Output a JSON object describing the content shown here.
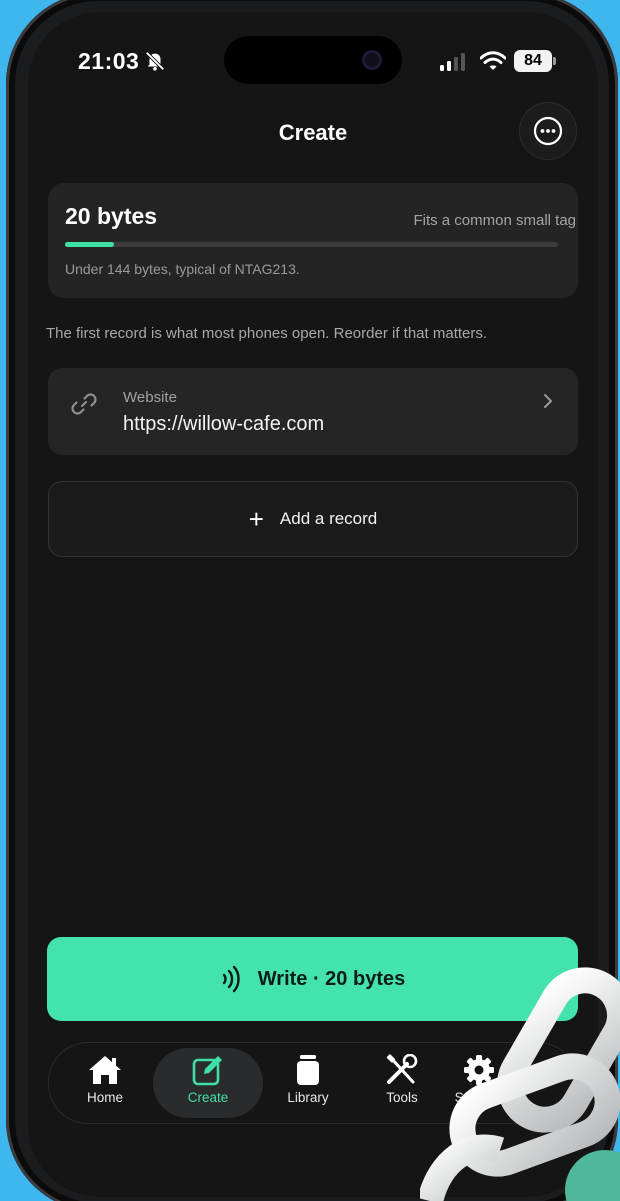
{
  "status_bar": {
    "time": "21:03",
    "battery": "84"
  },
  "header": {
    "title": "Create",
    "more_icon": "ellipsis-circle-icon"
  },
  "usage": {
    "bytes_label": "20 bytes",
    "fit_label": "Fits a common small tag",
    "note": "Under 144 bytes, typical of NTAG213.",
    "fill_fraction": 0.1,
    "accent_color": "#3ee0a6"
  },
  "hint": "The first record is what most phones open. Reorder if that matters.",
  "records": [
    {
      "type": "Website",
      "value": "https://willow-cafe.com",
      "icon": "link-icon"
    }
  ],
  "add_record": {
    "label": "Add a record"
  },
  "write_button": {
    "label": "Write · 20 bytes",
    "color": "#44e2ad"
  },
  "tabs": [
    {
      "label": "Home",
      "icon": "home-icon",
      "active": false
    },
    {
      "label": "Create",
      "icon": "edit-icon",
      "active": true
    },
    {
      "label": "Library",
      "icon": "library-icon",
      "active": false
    },
    {
      "label": "Tools",
      "icon": "tools-icon",
      "active": false
    },
    {
      "label": "Settings",
      "icon": "gear-icon",
      "active": false
    }
  ]
}
